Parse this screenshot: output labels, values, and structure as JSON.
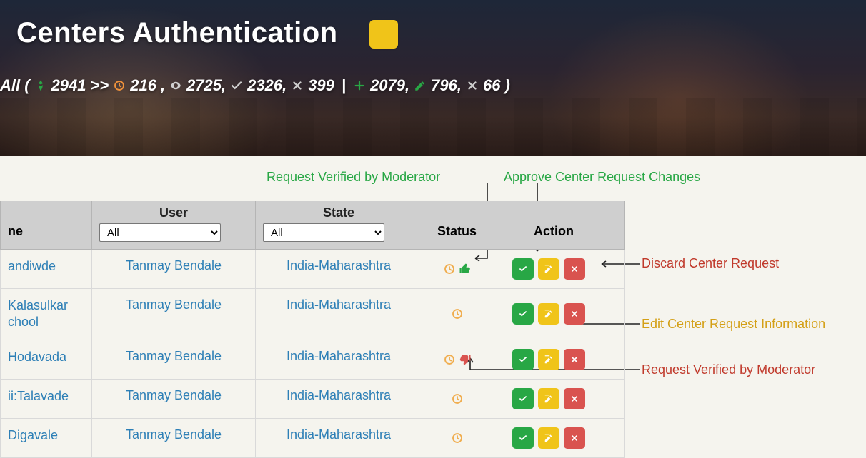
{
  "page": {
    "title": "Centers Authentication"
  },
  "stats": {
    "prefix": "All (",
    "launched": "2941",
    "arrows": ">>",
    "pending": "216",
    "comma": ",",
    "viewed": "2725,",
    "approved": "2326,",
    "rejected": "399",
    "pipe": "|",
    "added": "2079,",
    "edited": "796,",
    "cancelled": "66",
    "suffix": ")"
  },
  "table": {
    "headers": {
      "name": "ne",
      "user": "User",
      "state": "State",
      "status": "Status",
      "action": "Action"
    },
    "filters": {
      "user_options": [
        "All"
      ],
      "state_options": [
        "All"
      ],
      "user_selected": "All",
      "state_selected": "All"
    },
    "rows": [
      {
        "name": "andiwde",
        "user": "Tanmay Bendale",
        "state": "India-Maharashtra",
        "thumb": "up"
      },
      {
        "name": "Kalasulkar chool",
        "user": "Tanmay Bendale",
        "state": "India-Maharashtra",
        "thumb": "none"
      },
      {
        "name": "Hodavada",
        "user": "Tanmay Bendale",
        "state": "India-Maharashtra",
        "thumb": "down"
      },
      {
        "name": "ii:Talavade",
        "user": "Tanmay Bendale",
        "state": "India-Maharashtra",
        "thumb": "none"
      },
      {
        "name": "Digavale",
        "user": "Tanmay Bendale",
        "state": "India-Maharashtra",
        "thumb": "none"
      }
    ]
  },
  "annotations": {
    "verified_top": "Request Verified by Moderator",
    "approve": "Approve Center Request Changes",
    "discard": "Discard Center Request",
    "edit": "Edit Center Request Information",
    "verified_bottom": "Request Verified by Moderator"
  }
}
